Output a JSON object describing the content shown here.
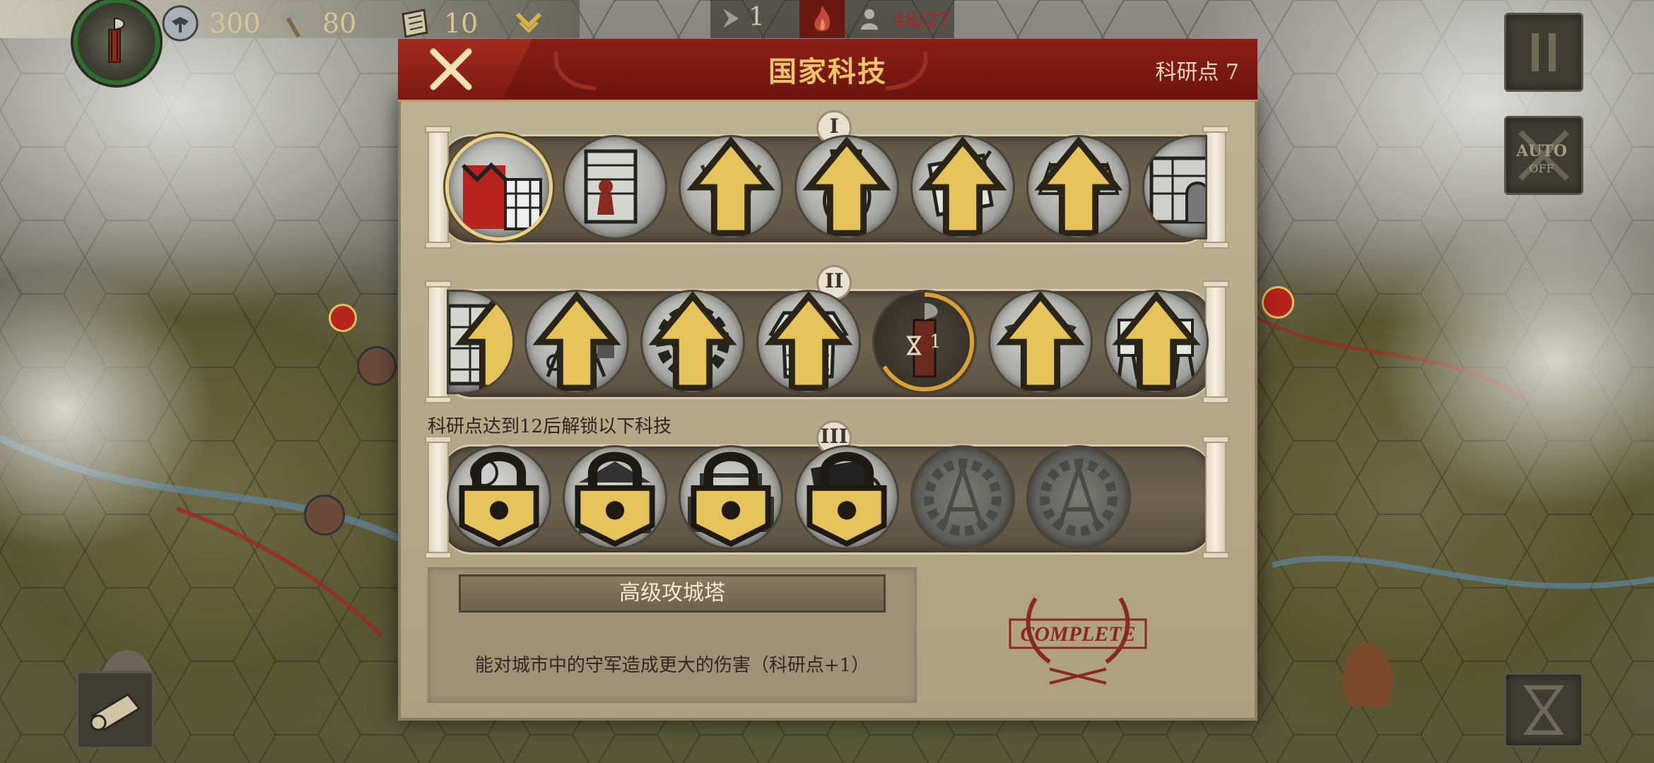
{
  "hud": {
    "silver": "300",
    "hammer": "80",
    "scroll": "10",
    "actions": "1",
    "population": "48/27"
  },
  "side_buttons": {
    "auto_label": "AUTO",
    "auto_state": "OFF"
  },
  "dialog": {
    "title": "国家科技",
    "research_points": "科研点 7",
    "tier_labels": [
      "I",
      "II",
      "III"
    ],
    "unlock_note": "科研点达到12后解锁以下科技",
    "tier1": [
      {
        "icon": "siege-tower-icon",
        "state": "selected"
      },
      {
        "icon": "gate-worker-icon",
        "state": "available"
      },
      {
        "icon": "wheat-icon",
        "state": "upgradable"
      },
      {
        "icon": "pitcher-icon",
        "state": "upgradable"
      },
      {
        "icon": "scroll-quill-icon",
        "state": "upgradable"
      },
      {
        "icon": "scales-icon",
        "state": "upgradable"
      },
      {
        "icon": "aqueduct-icon",
        "state": "available"
      }
    ],
    "tier2": [
      {
        "icon": "wall-icon",
        "state": "upgradable"
      },
      {
        "icon": "crane-icon",
        "state": "upgradable"
      },
      {
        "icon": "hammer-gear-icon",
        "state": "upgradable"
      },
      {
        "icon": "chainmail-icon",
        "state": "upgradable"
      },
      {
        "icon": "fasces-icon",
        "state": "researching",
        "timer": "1"
      },
      {
        "icon": "eagle-standard-icon",
        "state": "upgradable"
      },
      {
        "icon": "legion-march-icon",
        "state": "upgradable"
      }
    ],
    "tier3": [
      {
        "icon": "legionary-icon",
        "state": "locked"
      },
      {
        "icon": "temple-icon",
        "state": "locked"
      },
      {
        "icon": "forum-icon",
        "state": "locked"
      },
      {
        "icon": "document-icon",
        "state": "locked"
      },
      {
        "icon": "compass-gear-icon",
        "state": "hidden"
      },
      {
        "icon": "compass-gear-icon",
        "state": "hidden"
      }
    ],
    "selected_name": "高级攻城塔",
    "selected_desc": "能对城市中的守军造成更大的伤害（科研点+1）",
    "complete_stamp": "COMPLETE"
  },
  "colors": {
    "header_red": "#7a1a12",
    "title_gold": "#f0c66a",
    "parchment": "#b5a88a",
    "stamp_red": "#8a2a1e",
    "upgrade_gold": "#e6c35a"
  }
}
